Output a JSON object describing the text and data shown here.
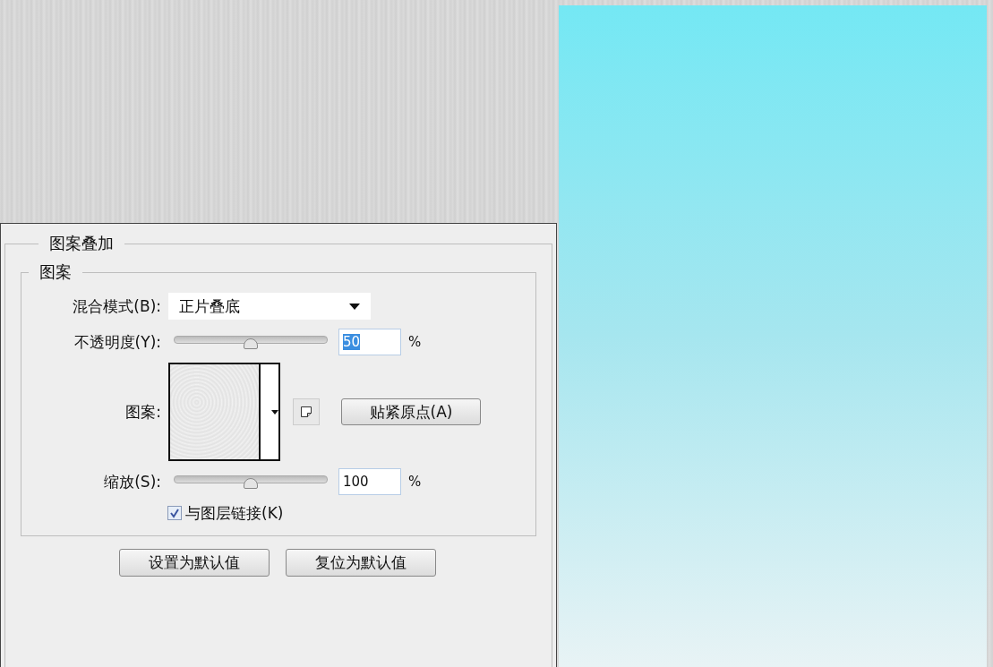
{
  "panel": {
    "title": "图案叠加",
    "group_title": "图案",
    "blend_mode": {
      "label": "混合模式(B):",
      "value": "正片叠底"
    },
    "opacity": {
      "label": "不透明度(Y):",
      "level": 0.5,
      "value": "50",
      "highlighted": true,
      "unit": "%"
    },
    "pattern": {
      "label": "图案:",
      "snap_button": "贴紧原点(A)"
    },
    "scale": {
      "label": "缩放(S):",
      "level": 0.5,
      "value": "100",
      "highlighted": false,
      "unit": "%"
    },
    "link": {
      "label": "与图层链接(K)",
      "checked": true
    },
    "buttons": [
      "设置为默认值",
      "复位为默认值"
    ]
  }
}
